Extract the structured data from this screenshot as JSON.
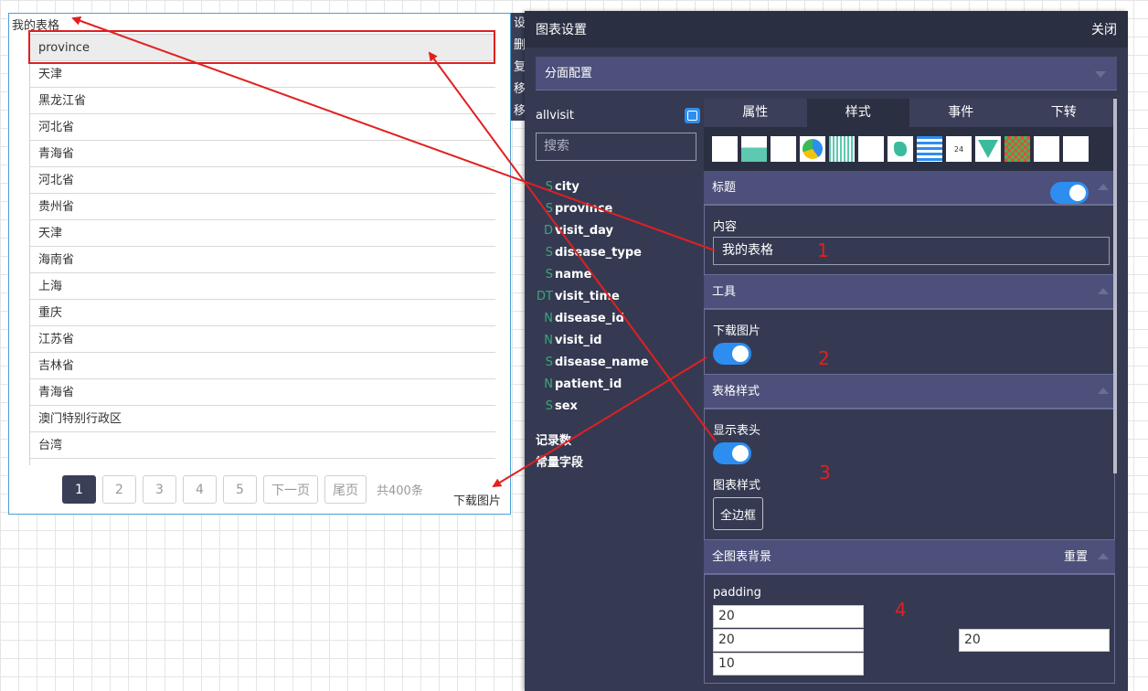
{
  "widget": {
    "title": "我的表格",
    "header": "province",
    "rows": [
      "天津",
      "黑龙江省",
      "河北省",
      "青海省",
      "河北省",
      "贵州省",
      "天津",
      "海南省",
      "上海",
      "重庆",
      "江苏省",
      "吉林省",
      "青海省",
      "澳门特别行政区",
      "台湾"
    ],
    "pager": {
      "pages": [
        "1",
        "2",
        "3",
        "4",
        "5"
      ],
      "next": "下一页",
      "last": "尾页",
      "total": "共400条"
    },
    "download_text": "下载图片"
  },
  "context_menu": [
    "设",
    "删",
    "复",
    "移",
    "移"
  ],
  "panel": {
    "title": "图表设置",
    "close": "关闭",
    "facet": "分面配置",
    "dataset": "allvisit",
    "search_placeholder": "搜索",
    "fields": [
      {
        "type": "S",
        "name": "city"
      },
      {
        "type": "S",
        "name": "province"
      },
      {
        "type": "D",
        "name": "visit_day"
      },
      {
        "type": "S",
        "name": "disease_type"
      },
      {
        "type": "S",
        "name": "name"
      },
      {
        "type": "DT",
        "name": "visit_time"
      },
      {
        "type": "N",
        "name": "disease_id"
      },
      {
        "type": "N",
        "name": "visit_id"
      },
      {
        "type": "S",
        "name": "disease_name"
      },
      {
        "type": "N",
        "name": "patient_id"
      },
      {
        "type": "S",
        "name": "sex"
      }
    ],
    "extra": [
      "记录数",
      "常量字段"
    ],
    "tabs": [
      "属性",
      "样式",
      "事件",
      "下转"
    ],
    "active_tab": "样式",
    "chart_icon_count_label": "24",
    "sections": {
      "title": {
        "label": "标题",
        "content_label": "内容",
        "content_value": "我的表格",
        "enabled": true
      },
      "tools": {
        "label": "工具",
        "download_label": "下载图片",
        "download_enabled": true
      },
      "table_style": {
        "label": "表格样式",
        "show_header_label": "显示表头",
        "show_header": true,
        "chart_style_label": "图表样式",
        "border_btn": "全边框"
      },
      "background": {
        "label": "全图表背景",
        "reset": "重置",
        "padding_label": "padding",
        "padding_values": [
          "20",
          "20",
          "10",
          "20"
        ]
      }
    }
  },
  "annotations": [
    "1",
    "2",
    "3",
    "4"
  ],
  "colors": {
    "accent": "#2d8ef0",
    "panel_bg": "#353a52",
    "header_bg": "#2b2f42",
    "section_bg": "#4c507a",
    "annotation": "#e02020"
  }
}
